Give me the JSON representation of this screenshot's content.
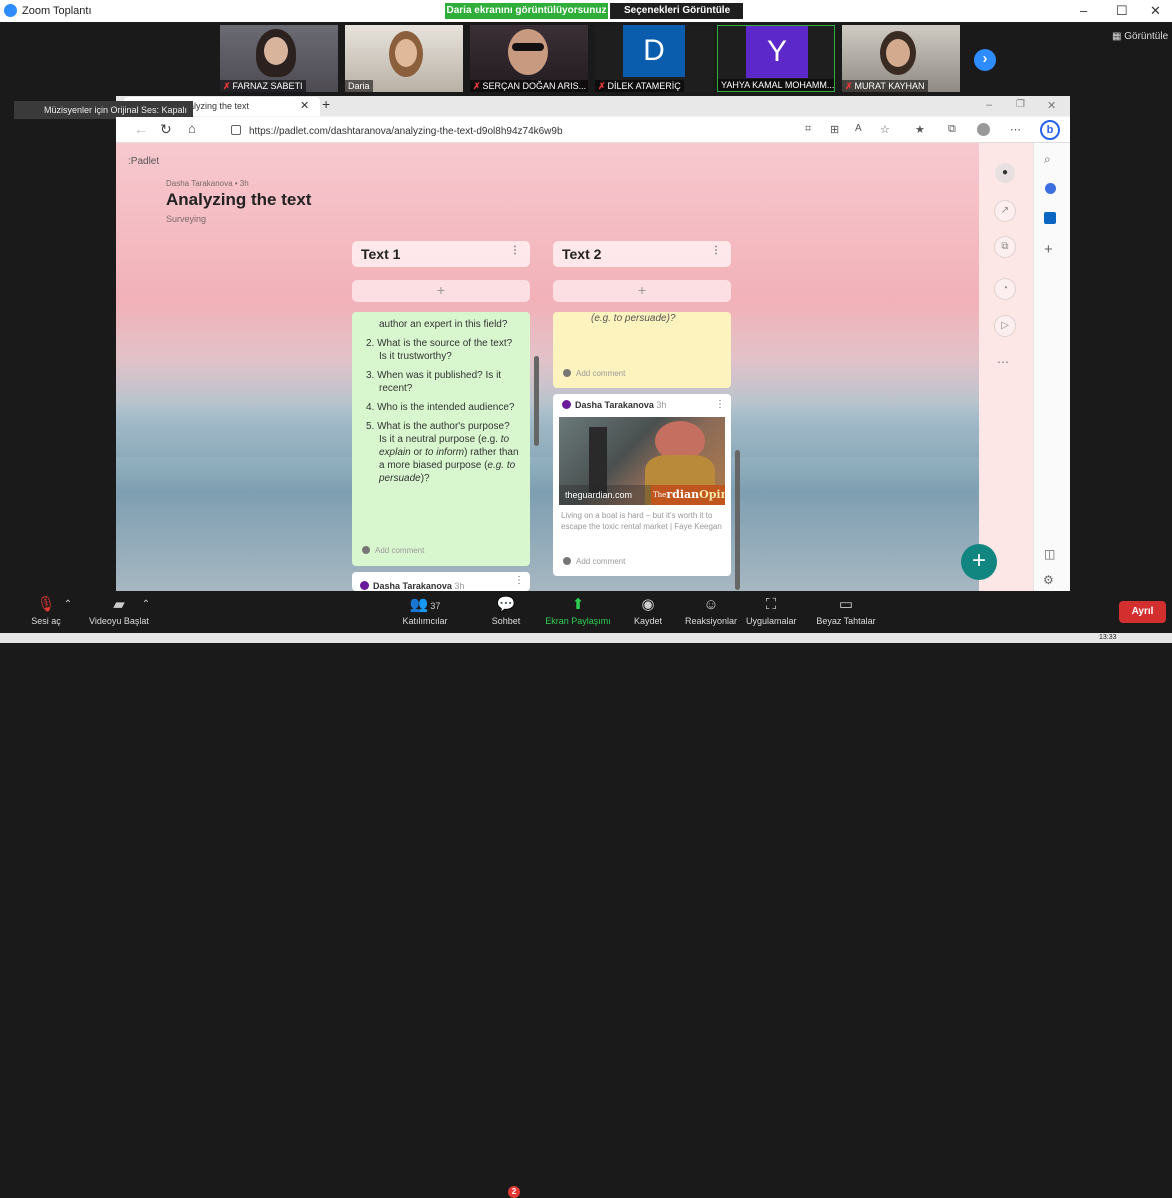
{
  "zoom": {
    "window_title": "Zoom Toplantı",
    "share_banner": "Daria ekranını görüntülüyorsunuz",
    "view_options": "Seçenekleri Görüntüle",
    "view_options_caret": "⌄",
    "view_button": "Görüntüle",
    "window_controls": [
      "–",
      "☐",
      "✕"
    ],
    "participants": [
      {
        "name": "FARNAZ SABETI",
        "muted": true,
        "type": "video"
      },
      {
        "name": "Daria",
        "muted": false,
        "type": "video"
      },
      {
        "name": "SERÇAN DOĞAN ARIS...",
        "muted": true,
        "type": "video"
      },
      {
        "name": "DİLEK ATAMERİÇ",
        "muted": true,
        "type": "letter",
        "letter": "D",
        "color": "#0a5cad"
      },
      {
        "name": "YAHYA KAMAL MOHAMM...",
        "muted": false,
        "type": "letter",
        "letter": "Y",
        "color": "#5c28c9"
      },
      {
        "name": "MURAT KAYHAN",
        "muted": true,
        "type": "video"
      }
    ],
    "music_banner": "Müzisyenler için Orijinal Ses: Kapalı",
    "toolbar": {
      "audio": "Sesi aç",
      "video": "Videoyu Başlat",
      "participants": "Katılımcılar",
      "participants_count": "37",
      "chat": "Sohbet",
      "chat_badge": "2",
      "share": "Ekran Paylaşımı",
      "record": "Kaydet",
      "reactions": "Reaksiyonlar",
      "apps": "Uygulamalar",
      "whiteboards": "Beyaz Tahtalar",
      "end": "Ayrıl"
    },
    "clock": "13:33"
  },
  "browser": {
    "tab_title": "Analyzing the text",
    "url": "https://padlet.com/dashtaranova/analyzing-the-text-d9ol8h94z74k6w9b",
    "accent": "#2563eb"
  },
  "padlet": {
    "logo": ":Padlet",
    "meta": "Dasha Tarakanova • 3h",
    "title": "Analyzing the text",
    "subtitle": "Surveying",
    "columns": [
      {
        "title": "Text 1"
      },
      {
        "title": "Text 2"
      }
    ],
    "col1_post": {
      "lines": [
        "author an expert in this field?",
        "2. What is the source of the text? Is it trustworthy?",
        "3. When was it published? Is it recent?",
        "4. Who is the intended audience?"
      ],
      "item5_pre": "5. What is the author's purpose? Is it a neutral purpose (e.g. ",
      "item5_em1": "to explain",
      "item5_mid1": " or ",
      "item5_em2": "to inform",
      "item5_mid2": ") rather than a more biased purpose (",
      "item5_em3": "e.g. to persuade",
      "item5_post": ")?",
      "comment": "Add comment",
      "bg": "#d9f7cf"
    },
    "col1_next": {
      "author": "Dasha Tarakanova",
      "when": "3h"
    },
    "col2_post": {
      "text": "(e.g. to persuade)?",
      "comment": "Add comment",
      "bg": "#fdf3bf"
    },
    "col2_link": {
      "author": "Dasha Tarakanova",
      "when": "3h",
      "source": "theguardian.com",
      "brand_pre": "The",
      "brand_a": "rdian",
      "brand_b": "Opinions",
      "caption": "Living on a boat is hard – but it's worth it to escape the toxic rental market | Faye Keegan",
      "comment": "Add comment"
    }
  }
}
